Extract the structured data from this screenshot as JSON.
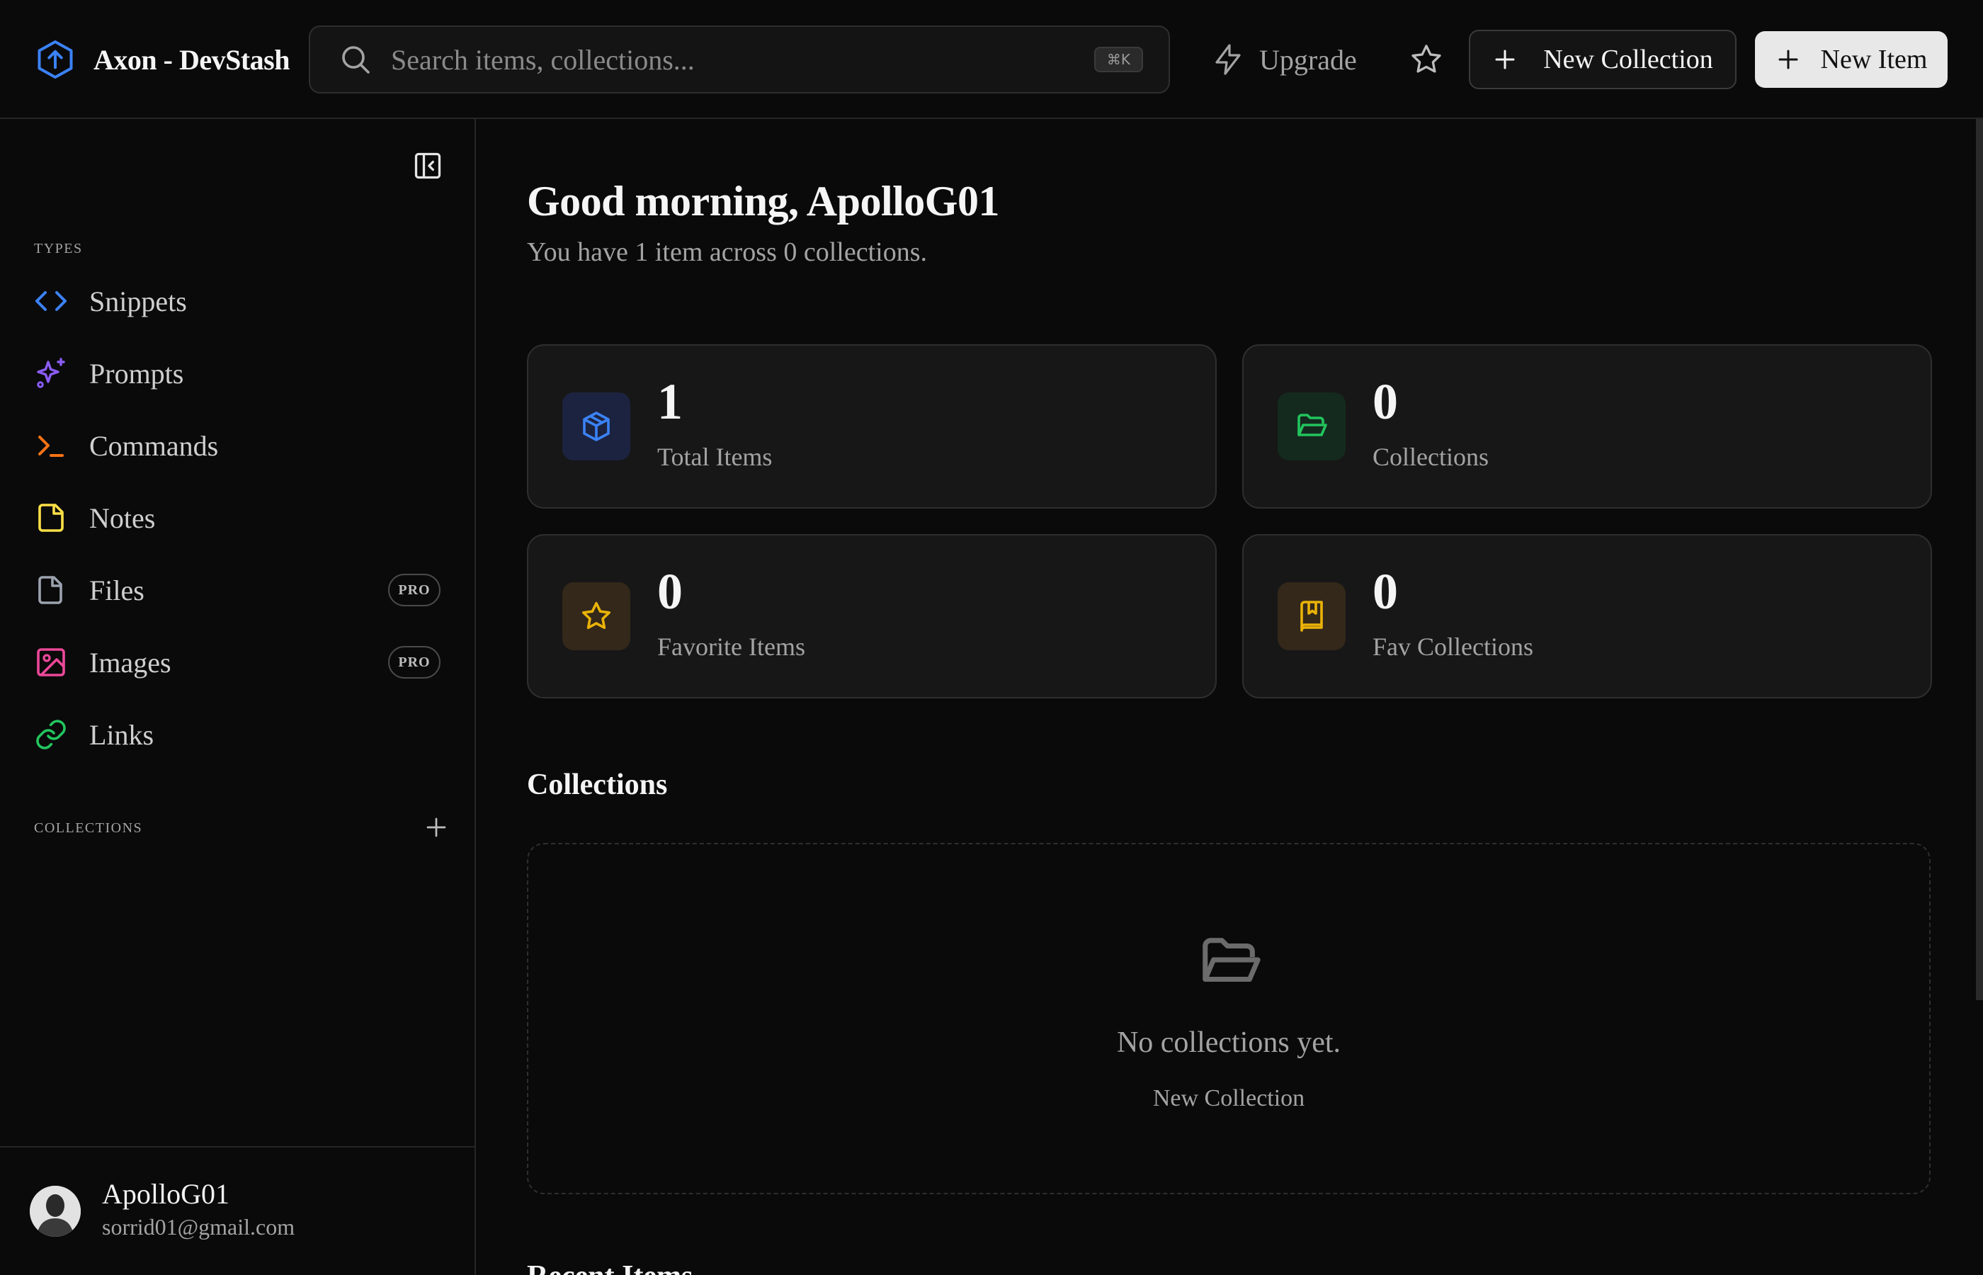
{
  "header": {
    "brand_name": "Axon - DevStash",
    "search_placeholder": "Search items, collections...",
    "search_shortcut": "⌘K",
    "upgrade_label": "Upgrade",
    "new_collection_label": "New Collection",
    "new_item_label": "New Item"
  },
  "sidebar": {
    "types_label": "TYPES",
    "items": [
      {
        "label": "Snippets",
        "icon": "code-icon",
        "color": "#3b82f6"
      },
      {
        "label": "Prompts",
        "icon": "sparkles-icon",
        "color": "#8b5cf6"
      },
      {
        "label": "Commands",
        "icon": "terminal-icon",
        "color": "#f97316"
      },
      {
        "label": "Notes",
        "icon": "note-icon",
        "color": "#fde047"
      },
      {
        "label": "Files",
        "icon": "file-icon",
        "color": "#9ca3af",
        "badge": "PRO"
      },
      {
        "label": "Images",
        "icon": "image-icon",
        "color": "#ec4899",
        "badge": "PRO"
      },
      {
        "label": "Links",
        "icon": "link-icon",
        "color": "#22c55e"
      }
    ],
    "collections_label": "COLLECTIONS",
    "user": {
      "name": "ApolloG01",
      "email": "sorrid01@gmail.com"
    }
  },
  "main": {
    "greeting": "Good morning, ApolloG01",
    "subtitle": "You have 1 item across 0 collections.",
    "stats": [
      {
        "value": "1",
        "label": "Total Items",
        "icon": "box-icon",
        "color": "#3b82f6"
      },
      {
        "value": "0",
        "label": "Collections",
        "icon": "folder-open-icon",
        "color": "#22c55e"
      },
      {
        "value": "0",
        "label": "Favorite Items",
        "icon": "star-icon",
        "color": "#eab308"
      },
      {
        "value": "0",
        "label": "Fav Collections",
        "icon": "bookmark-book-icon",
        "color": "#eab308"
      }
    ],
    "collections_title": "Collections",
    "empty_message": "No collections yet.",
    "empty_action": "New Collection",
    "next_section_title": "Recent Items"
  }
}
